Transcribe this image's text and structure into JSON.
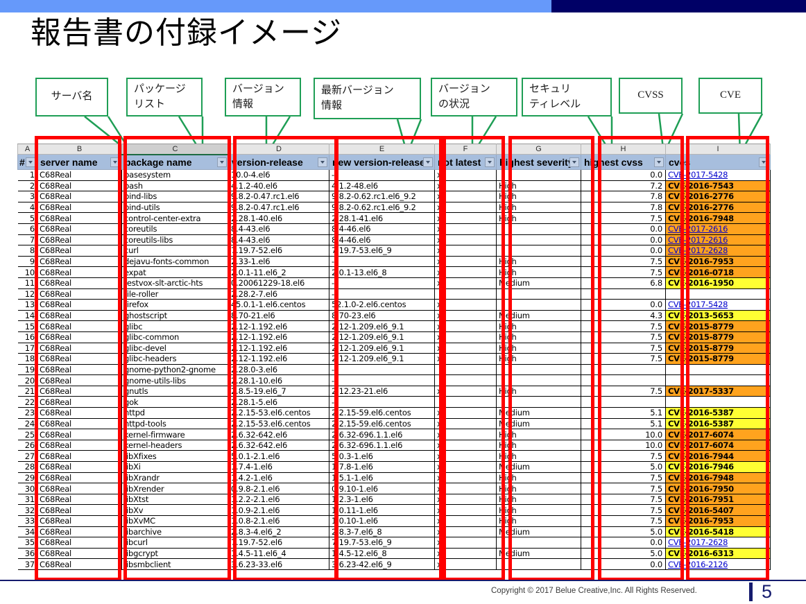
{
  "banner": {
    "left_color": "#6699fa",
    "right_color": "#000066"
  },
  "title": "報告書の付録イメージ",
  "callouts": [
    {
      "name": "server-name",
      "text": "サーバ名",
      "centered": true
    },
    {
      "name": "package-list",
      "text": "パッケージ\nリスト",
      "centered": false
    },
    {
      "name": "version-info",
      "text": "バージョン\n情報",
      "centered": false
    },
    {
      "name": "latest-version-info",
      "text": "最新バージョン\n情報",
      "centered": false
    },
    {
      "name": "version-status",
      "text": "バージョン\nの状況",
      "centered": false
    },
    {
      "name": "security-level",
      "text": "セキュリ\nティレベル",
      "centered": false
    },
    {
      "name": "cvss",
      "text": "CVSS",
      "centered": true
    },
    {
      "name": "cve",
      "text": "CVE",
      "centered": true
    }
  ],
  "sheet": {
    "column_letters": [
      "A",
      "B",
      "C",
      "D",
      "E",
      "F",
      "G",
      "H",
      "I"
    ],
    "selected_column": "C",
    "headers": [
      "#",
      "server name",
      "package name",
      "version-release",
      "new version-release",
      "not latest",
      "highest severity",
      "highest cvss",
      "cves"
    ],
    "rows": [
      {
        "n": "1",
        "server": "C68Real",
        "pkg": "basesystem",
        "ver": "10.0-4.el6",
        "new": "-",
        "notlatest": "x",
        "sev": "",
        "cvss": "0.0",
        "cve": "CVE-2017-5428",
        "cve_style": "link"
      },
      {
        "n": "2",
        "server": "C68Real",
        "pkg": "bash",
        "ver": "4.1.2-40.el6",
        "new": "4.1.2-48.el6",
        "notlatest": "x",
        "sev": "High",
        "cvss": "7.2",
        "cve": "CVE-2016-7543",
        "cve_style": "orange"
      },
      {
        "n": "3",
        "server": "C68Real",
        "pkg": "bind-libs",
        "ver": "9.8.2-0.47.rc1.el6",
        "new": "9.8.2-0.62.rc1.el6_9.2",
        "notlatest": "x",
        "sev": "High",
        "cvss": "7.8",
        "cve": "CVE-2016-2776",
        "cve_style": "orange"
      },
      {
        "n": "4",
        "server": "C68Real",
        "pkg": "bind-utils",
        "ver": "9.8.2-0.47.rc1.el6",
        "new": "9.8.2-0.62.rc1.el6_9.2",
        "notlatest": "x",
        "sev": "High",
        "cvss": "7.8",
        "cve": "CVE-2016-2776",
        "cve_style": "orange"
      },
      {
        "n": "5",
        "server": "C68Real",
        "pkg": "control-center-extra",
        "ver": "2.28.1-40.el6",
        "new": "2.28.1-41.el6",
        "notlatest": "x",
        "sev": "High",
        "cvss": "7.5",
        "cve": "CVE-2016-7948",
        "cve_style": "orange"
      },
      {
        "n": "6",
        "server": "C68Real",
        "pkg": "coreutils",
        "ver": "8.4-43.el6",
        "new": "8.4-46.el6",
        "notlatest": "x",
        "sev": "",
        "cvss": "0.0",
        "cve": "CVE-2017-2616",
        "cve_style": "link-orange"
      },
      {
        "n": "7",
        "server": "C68Real",
        "pkg": "coreutils-libs",
        "ver": "8.4-43.el6",
        "new": "8.4-46.el6",
        "notlatest": "x",
        "sev": "",
        "cvss": "0.0",
        "cve": "CVE-2017-2616",
        "cve_style": "link-orange"
      },
      {
        "n": "8",
        "server": "C68Real",
        "pkg": "curl",
        "ver": "7.19.7-52.el6",
        "new": "7.19.7-53.el6_9",
        "notlatest": "x",
        "sev": "",
        "cvss": "0.0",
        "cve": "CVE-2017-2628",
        "cve_style": "link-orange"
      },
      {
        "n": "9",
        "server": "C68Real",
        "pkg": "dejavu-fonts-common",
        "ver": "2.33-1.el6",
        "new": "-",
        "notlatest": "x",
        "sev": "High",
        "cvss": "7.5",
        "cve": "CVE-2016-7953",
        "cve_style": "orange"
      },
      {
        "n": "10",
        "server": "C68Real",
        "pkg": "expat",
        "ver": "2.0.1-11.el6_2",
        "new": "2.0.1-13.el6_8",
        "notlatest": "x",
        "sev": "High",
        "cvss": "7.5",
        "cve": "CVE-2016-0718",
        "cve_style": "orange"
      },
      {
        "n": "11",
        "server": "C68Real",
        "pkg": "festvox-slt-arctic-hts",
        "ver": "0.20061229-18.el6",
        "new": "-",
        "notlatest": "x",
        "sev": "Medium",
        "cvss": "6.8",
        "cve": "CVE-2016-1950",
        "cve_style": "yellow"
      },
      {
        "n": "12",
        "server": "C68Real",
        "pkg": "file-roller",
        "ver": "2.28.2-7.el6",
        "new": "-",
        "notlatest": "",
        "sev": "",
        "cvss": "",
        "cve": "",
        "cve_style": "plain"
      },
      {
        "n": "13",
        "server": "C68Real",
        "pkg": "firefox",
        "ver": "45.0.1-1.el6.centos",
        "new": "52.1.0-2.el6.centos",
        "notlatest": "x",
        "sev": "",
        "cvss": "0.0",
        "cve": "CVE-2017-5428",
        "cve_style": "link"
      },
      {
        "n": "14",
        "server": "C68Real",
        "pkg": "ghostscript",
        "ver": "8.70-21.el6",
        "new": "8.70-23.el6",
        "notlatest": "x",
        "sev": "Medium",
        "cvss": "4.3",
        "cve": "CVE-2013-5653",
        "cve_style": "yellow"
      },
      {
        "n": "15",
        "server": "C68Real",
        "pkg": "glibc",
        "ver": "2.12-1.192.el6",
        "new": "2.12-1.209.el6_9.1",
        "notlatest": "x",
        "sev": "High",
        "cvss": "7.5",
        "cve": "CVE-2015-8779",
        "cve_style": "orange"
      },
      {
        "n": "16",
        "server": "C68Real",
        "pkg": "glibc-common",
        "ver": "2.12-1.192.el6",
        "new": "2.12-1.209.el6_9.1",
        "notlatest": "x",
        "sev": "High",
        "cvss": "7.5",
        "cve": "CVE-2015-8779",
        "cve_style": "orange"
      },
      {
        "n": "17",
        "server": "C68Real",
        "pkg": "glibc-devel",
        "ver": "2.12-1.192.el6",
        "new": "2.12-1.209.el6_9.1",
        "notlatest": "x",
        "sev": "High",
        "cvss": "7.5",
        "cve": "CVE-2015-8779",
        "cve_style": "orange"
      },
      {
        "n": "18",
        "server": "C68Real",
        "pkg": "glibc-headers",
        "ver": "2.12-1.192.el6",
        "new": "2.12-1.209.el6_9.1",
        "notlatest": "x",
        "sev": "High",
        "cvss": "7.5",
        "cve": "CVE-2015-8779",
        "cve_style": "orange"
      },
      {
        "n": "19",
        "server": "C68Real",
        "pkg": "gnome-python2-gnome",
        "ver": "2.28.0-3.el6",
        "new": "-",
        "notlatest": "",
        "sev": "",
        "cvss": "",
        "cve": "",
        "cve_style": "plain"
      },
      {
        "n": "20",
        "server": "C68Real",
        "pkg": "gnome-utils-libs",
        "ver": "2.28.1-10.el6",
        "new": "-",
        "notlatest": "",
        "sev": "",
        "cvss": "",
        "cve": "",
        "cve_style": "plain"
      },
      {
        "n": "21",
        "server": "C68Real",
        "pkg": "gnutls",
        "ver": "2.8.5-19.el6_7",
        "new": "2.12.23-21.el6",
        "notlatest": "x",
        "sev": "High",
        "cvss": "7.5",
        "cve": "CVE-2017-5337",
        "cve_style": "orange"
      },
      {
        "n": "22",
        "server": "C68Real",
        "pkg": "gok",
        "ver": "2.28.1-5.el6",
        "new": "-",
        "notlatest": "",
        "sev": "",
        "cvss": "",
        "cve": "",
        "cve_style": "plain"
      },
      {
        "n": "23",
        "server": "C68Real",
        "pkg": "httpd",
        "ver": "2.2.15-53.el6.centos",
        "new": "2.2.15-59.el6.centos",
        "notlatest": "x",
        "sev": "Medium",
        "cvss": "5.1",
        "cve": "CVE-2016-5387",
        "cve_style": "yellow"
      },
      {
        "n": "24",
        "server": "C68Real",
        "pkg": "httpd-tools",
        "ver": "2.2.15-53.el6.centos",
        "new": "2.2.15-59.el6.centos",
        "notlatest": "x",
        "sev": "Medium",
        "cvss": "5.1",
        "cve": "CVE-2016-5387",
        "cve_style": "yellow"
      },
      {
        "n": "25",
        "server": "C68Real",
        "pkg": "kernel-firmware",
        "ver": "2.6.32-642.el6",
        "new": "2.6.32-696.1.1.el6",
        "notlatest": "x",
        "sev": "High",
        "cvss": "10.0",
        "cve": "CVE-2017-6074",
        "cve_style": "orange"
      },
      {
        "n": "26",
        "server": "C68Real",
        "pkg": "kernel-headers",
        "ver": "2.6.32-642.el6",
        "new": "2.6.32-696.1.1.el6",
        "notlatest": "x",
        "sev": "High",
        "cvss": "10.0",
        "cve": "CVE-2017-6074",
        "cve_style": "orange"
      },
      {
        "n": "27",
        "server": "C68Real",
        "pkg": "libXfixes",
        "ver": "5.0.1-2.1.el6",
        "new": "5.0.3-1.el6",
        "notlatest": "x",
        "sev": "High",
        "cvss": "7.5",
        "cve": "CVE-2016-7944",
        "cve_style": "orange"
      },
      {
        "n": "28",
        "server": "C68Real",
        "pkg": "libXi",
        "ver": "1.7.4-1.el6",
        "new": "1.7.8-1.el6",
        "notlatest": "x",
        "sev": "Medium",
        "cvss": "5.0",
        "cve": "CVE-2016-7946",
        "cve_style": "yellow"
      },
      {
        "n": "29",
        "server": "C68Real",
        "pkg": "libXrandr",
        "ver": "1.4.2-1.el6",
        "new": "1.5.1-1.el6",
        "notlatest": "x",
        "sev": "High",
        "cvss": "7.5",
        "cve": "CVE-2016-7948",
        "cve_style": "orange"
      },
      {
        "n": "30",
        "server": "C68Real",
        "pkg": "libXrender",
        "ver": "0.9.8-2.1.el6",
        "new": "0.9.10-1.el6",
        "notlatest": "x",
        "sev": "High",
        "cvss": "7.5",
        "cve": "CVE-2016-7950",
        "cve_style": "orange"
      },
      {
        "n": "31",
        "server": "C68Real",
        "pkg": "libXtst",
        "ver": "1.2.2-2.1.el6",
        "new": "1.2.3-1.el6",
        "notlatest": "x",
        "sev": "High",
        "cvss": "7.5",
        "cve": "CVE-2016-7951",
        "cve_style": "orange"
      },
      {
        "n": "32",
        "server": "C68Real",
        "pkg": "libXv",
        "ver": "1.0.9-2.1.el6",
        "new": "1.0.11-1.el6",
        "notlatest": "x",
        "sev": "High",
        "cvss": "7.5",
        "cve": "CVE-2016-5407",
        "cve_style": "orange"
      },
      {
        "n": "33",
        "server": "C68Real",
        "pkg": "libXvMC",
        "ver": "1.0.8-2.1.el6",
        "new": "1.0.10-1.el6",
        "notlatest": "x",
        "sev": "High",
        "cvss": "7.5",
        "cve": "CVE-2016-7953",
        "cve_style": "orange"
      },
      {
        "n": "34",
        "server": "C68Real",
        "pkg": "libarchive",
        "ver": "2.8.3-4.el6_2",
        "new": "2.8.3-7.el6_8",
        "notlatest": "x",
        "sev": "Medium",
        "cvss": "5.0",
        "cve": "CVE-2016-5418",
        "cve_style": "yellow"
      },
      {
        "n": "35",
        "server": "C68Real",
        "pkg": "libcurl",
        "ver": "7.19.7-52.el6",
        "new": "7.19.7-53.el6_9",
        "notlatest": "x",
        "sev": "",
        "cvss": "0.0",
        "cve": "CVE-2017-2628",
        "cve_style": "link"
      },
      {
        "n": "36",
        "server": "C68Real",
        "pkg": "libgcrypt",
        "ver": "1.4.5-11.el6_4",
        "new": "1.4.5-12.el6_8",
        "notlatest": "x",
        "sev": "Medium",
        "cvss": "5.0",
        "cve": "CVE-2016-6313",
        "cve_style": "yellow"
      },
      {
        "n": "37",
        "server": "C68Real",
        "pkg": "libsmbclient",
        "ver": "3.6.23-33.el6",
        "new": "3.6.23-42.el6_9",
        "notlatest": "x",
        "sev": "",
        "cvss": "0.0",
        "cve": "CVE-2016-2126",
        "cve_style": "link"
      }
    ]
  },
  "footer": {
    "copyright": "Copyright © 2017 Belue Creative,Inc. All  Rights Reserved.",
    "page_number": "5"
  },
  "colors": {
    "highlight_box": "#ff0000",
    "callout_border": "#1e9e55",
    "header_fill": "#a7bedd",
    "severity_high": "#ffa31e",
    "severity_medium": "#ffff33",
    "link": "#0000cc"
  }
}
